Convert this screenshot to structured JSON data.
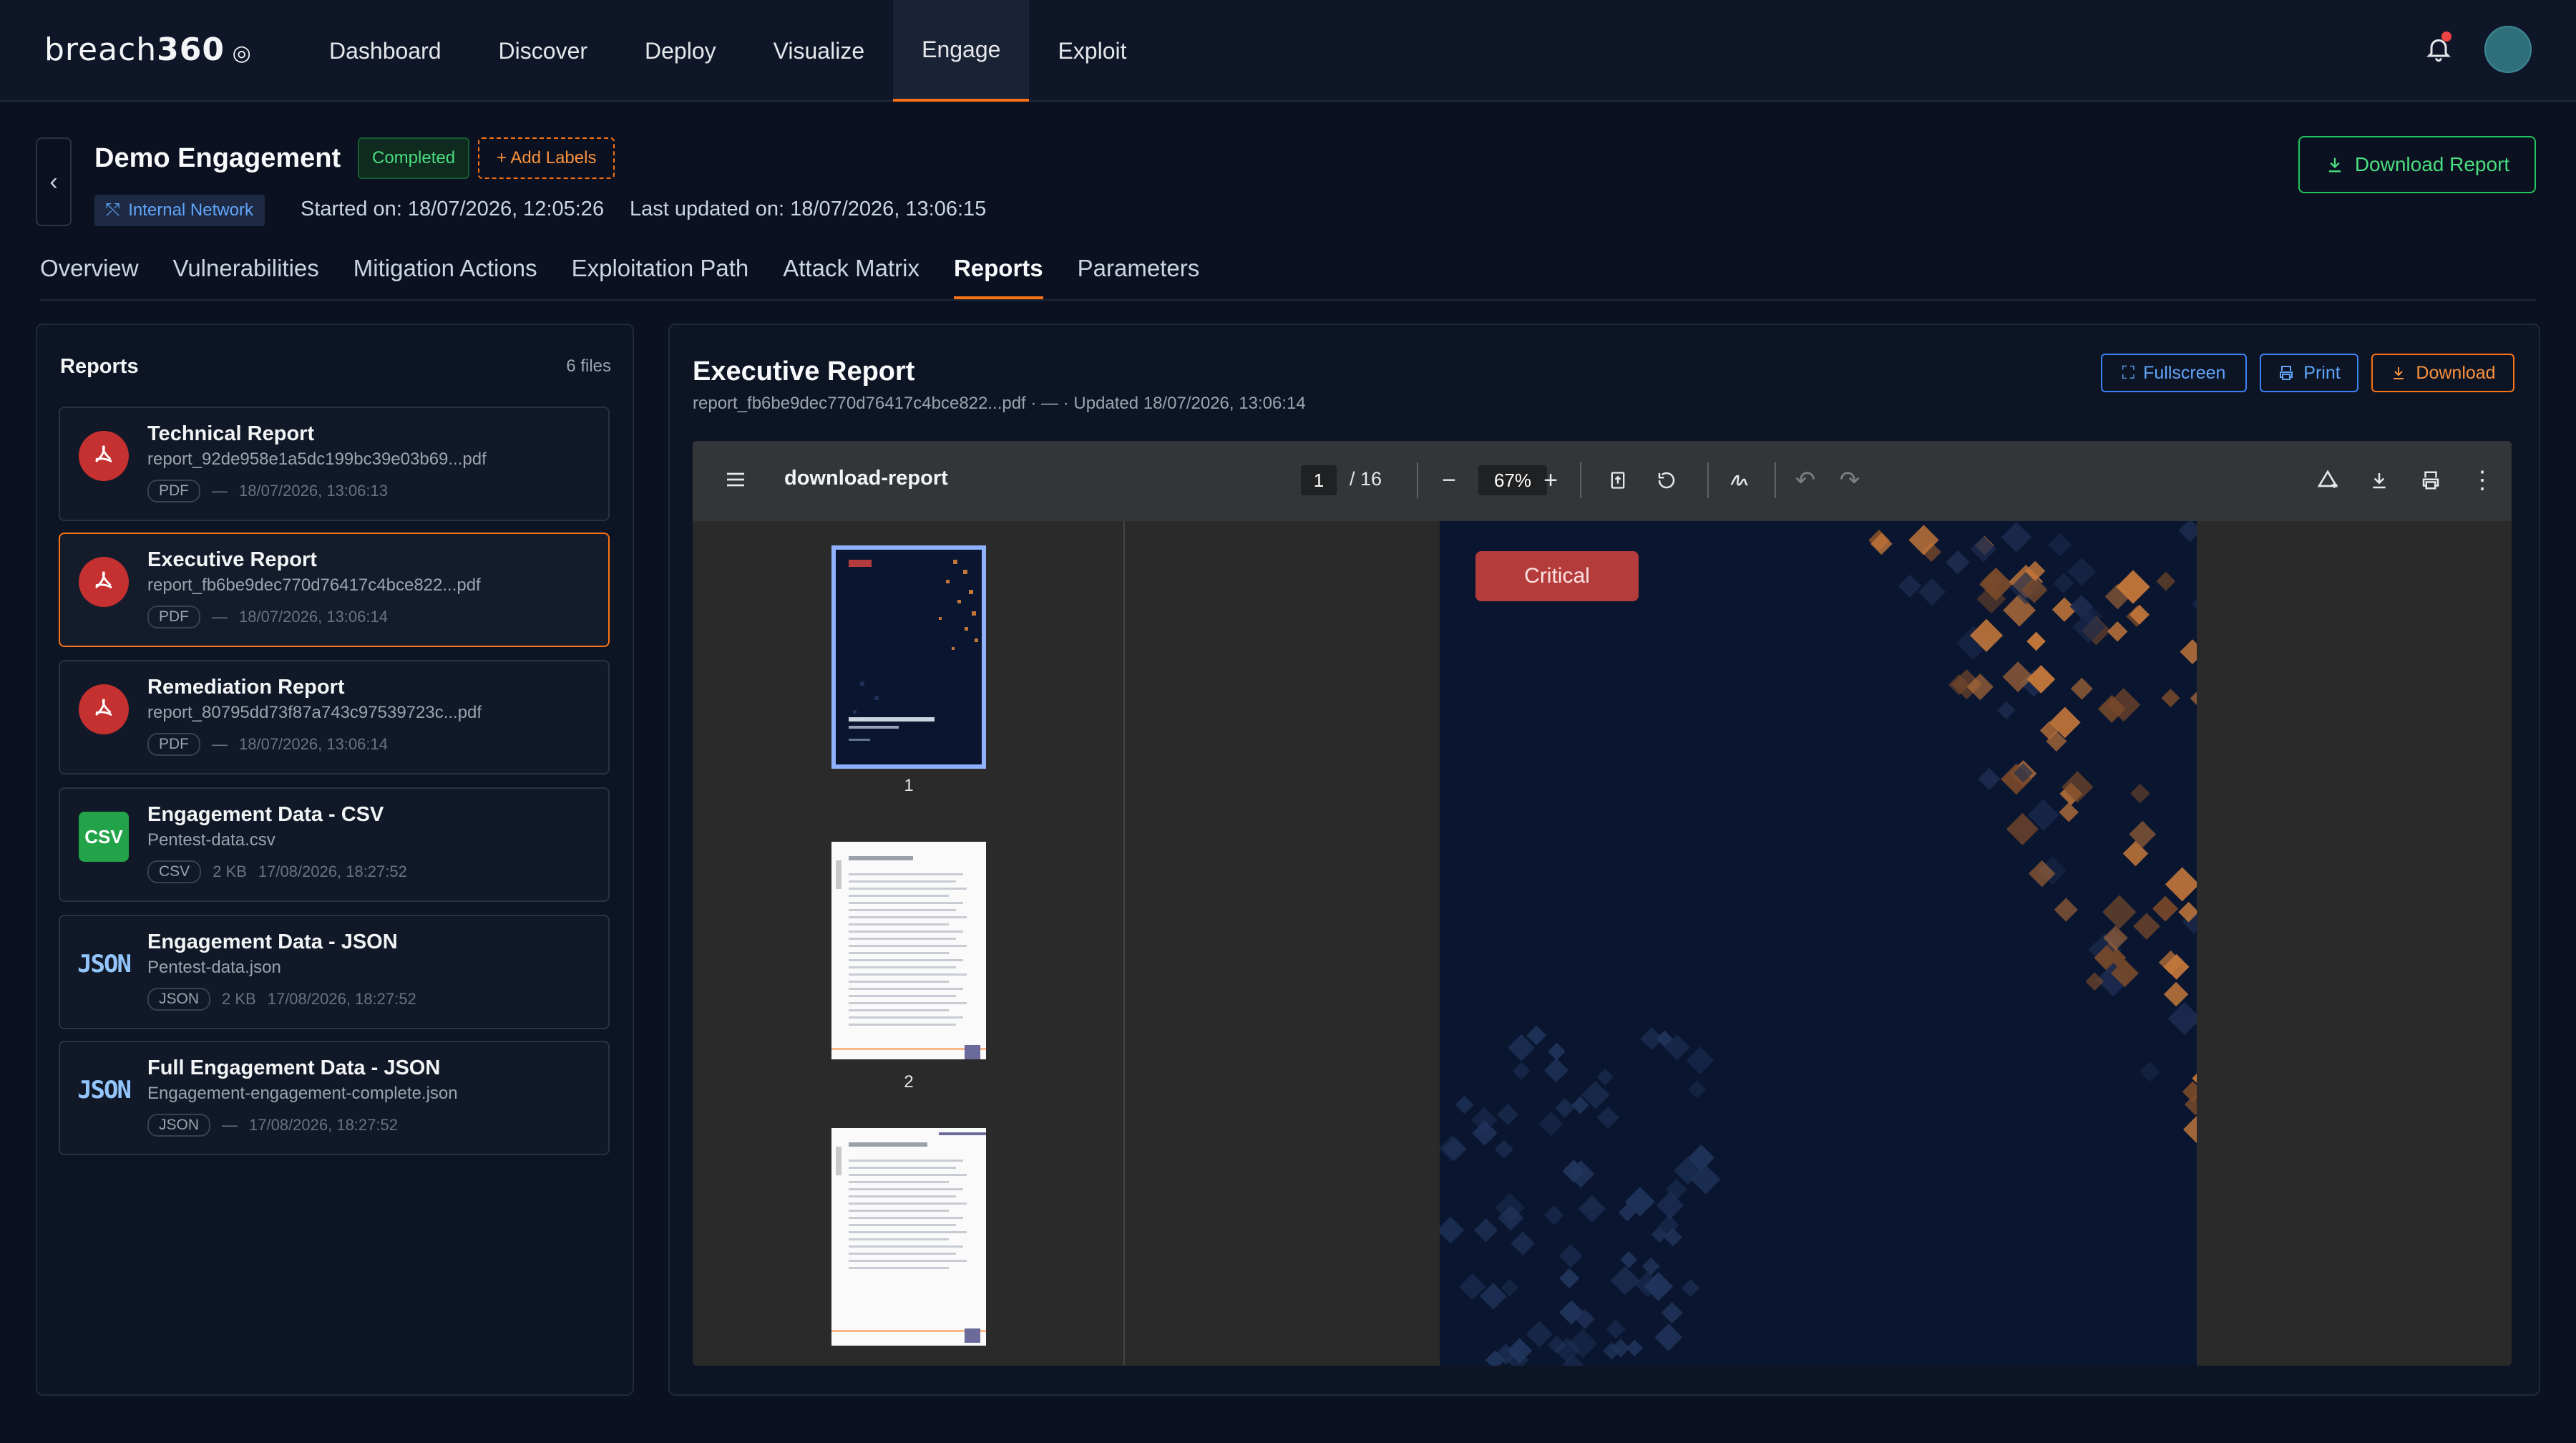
{
  "app": {
    "logo_text": "breach",
    "logo_bold": "360"
  },
  "nav": {
    "items": [
      {
        "label": "Dashboard"
      },
      {
        "label": "Discover"
      },
      {
        "label": "Deploy"
      },
      {
        "label": "Visualize"
      },
      {
        "label": "Engage"
      },
      {
        "label": "Exploit"
      }
    ],
    "active": "Engage"
  },
  "engagement": {
    "title": "Demo Engagement",
    "status": "Completed",
    "add_labels": "+ Add Labels",
    "network_tag": "Internal Network",
    "started": "Started on: 18/07/2026, 12:05:26",
    "updated": "Last updated on: 18/07/2026, 13:06:15",
    "download_report": "Download Report"
  },
  "tabs": [
    {
      "label": "Overview"
    },
    {
      "label": "Vulnerabilities"
    },
    {
      "label": "Mitigation Actions"
    },
    {
      "label": "Exploitation Path"
    },
    {
      "label": "Attack Matrix"
    },
    {
      "label": "Reports"
    },
    {
      "label": "Parameters"
    }
  ],
  "reports_panel": {
    "title": "Reports",
    "count": "6 files",
    "files": [
      {
        "name": "Technical Report",
        "file": "report_92de958e1a5dc199bc39e03b69...pdf",
        "type": "PDF",
        "size": "—",
        "date": "18/07/2026, 13:06:13",
        "icon": "pdf-icon"
      },
      {
        "name": "Executive Report",
        "file": "report_fb6be9dec770d76417c4bce822...pdf",
        "type": "PDF",
        "size": "—",
        "date": "18/07/2026, 13:06:14",
        "icon": "pdf-icon"
      },
      {
        "name": "Remediation Report",
        "file": "report_80795dd73f87a743c97539723c...pdf",
        "type": "PDF",
        "size": "—",
        "date": "18/07/2026, 13:06:14",
        "icon": "pdf-icon"
      },
      {
        "name": "Engagement Data - CSV",
        "file": "Pentest-data.csv",
        "type": "CSV",
        "size": "2 KB",
        "date": "17/08/2026, 18:27:52",
        "icon": "csv-icon",
        "icon_text": "CSV"
      },
      {
        "name": "Engagement Data - JSON",
        "file": "Pentest-data.json",
        "type": "JSON",
        "size": "2 KB",
        "date": "17/08/2026, 18:27:52",
        "icon": "json-icon",
        "icon_text": "JSON"
      },
      {
        "name": "Full Engagement Data - JSON",
        "file": "Engagement-engagement-complete.json",
        "type": "JSON",
        "size": "—",
        "date": "17/08/2026, 18:27:52",
        "icon": "json-icon",
        "icon_text": "JSON"
      }
    ]
  },
  "viewer": {
    "title": "Executive Report",
    "subtitle": "report_fb6be9dec770d76417c4bce822...pdf · — · Updated 18/07/2026, 13:06:14",
    "fullscreen": "Fullscreen",
    "print": "Print",
    "download": "Download",
    "doc_name": "download-report",
    "page": "1",
    "total": "/ 16",
    "zoom": "67%",
    "thumb_labels": [
      "1",
      "2"
    ],
    "badge": "Critical",
    "cover_title": "Executive Pentesting Report"
  },
  "colors": {
    "accent": "#f97316",
    "success": "#22c55e",
    "link": "#3b82f6",
    "critical": "#b43c3c"
  }
}
